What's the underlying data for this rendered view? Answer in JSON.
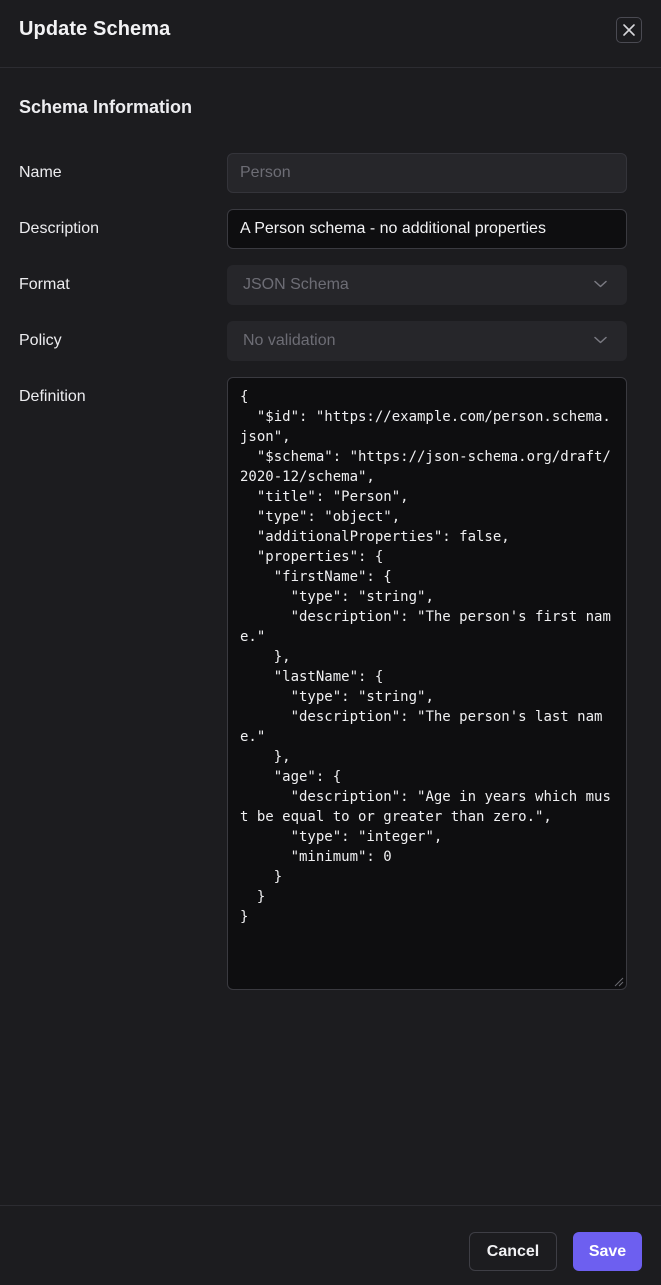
{
  "dialog": {
    "title": "Update Schema",
    "close_icon": "close-icon"
  },
  "section": {
    "title": "Schema Information"
  },
  "fields": {
    "name": {
      "label": "Name",
      "value": "Person"
    },
    "description": {
      "label": "Description",
      "value": "A Person schema - no additional properties"
    },
    "format": {
      "label": "Format",
      "value": "JSON Schema",
      "icon": "chevron-down-icon"
    },
    "policy": {
      "label": "Policy",
      "value": "No validation",
      "icon": "chevron-down-icon"
    },
    "definition": {
      "label": "Definition",
      "value": "{\n  \"$id\": \"https://example.com/person.schema.json\",\n  \"$schema\": \"https://json-schema.org/draft/2020-12/schema\",\n  \"title\": \"Person\",\n  \"type\": \"object\",\n  \"additionalProperties\": false,\n  \"properties\": {\n    \"firstName\": {\n      \"type\": \"string\",\n      \"description\": \"The person's first name.\"\n    },\n    \"lastName\": {\n      \"type\": \"string\",\n      \"description\": \"The person's last name.\"\n    },\n    \"age\": {\n      \"description\": \"Age in years which must be equal to or greater than zero.\",\n      \"type\": \"integer\",\n      \"minimum\": 0\n    }\n  }\n}"
    }
  },
  "footer": {
    "cancel_label": "Cancel",
    "save_label": "Save"
  },
  "colors": {
    "background": "#1c1c1f",
    "input_background": "#0e0e10",
    "disabled_background": "#26262a",
    "accent": "#6d5ff0"
  }
}
